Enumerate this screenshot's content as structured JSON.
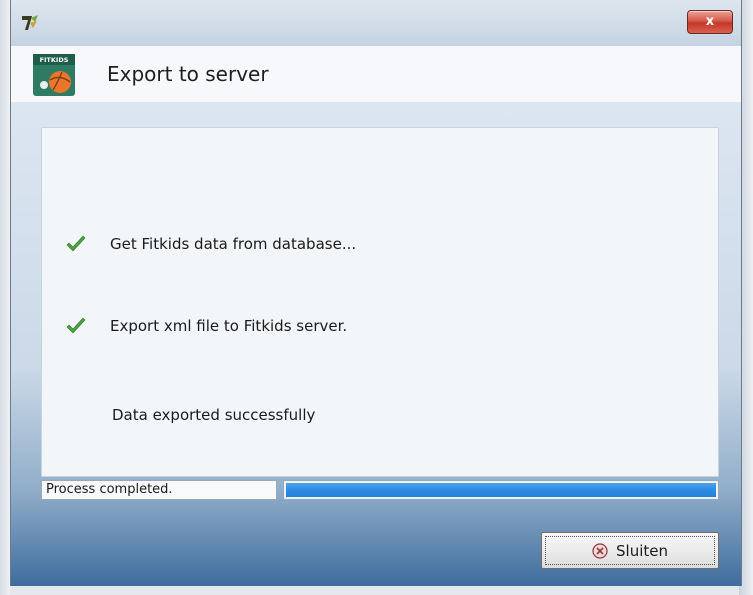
{
  "window": {
    "close_glyph": "x"
  },
  "header": {
    "title": "Export to server",
    "logo_text": "FITKIDS"
  },
  "steps": [
    {
      "label": "Get Fitkids data from database...",
      "status": "done",
      "icon": "check-icon"
    },
    {
      "label": "Export xml file to Fitkids server.",
      "status": "done",
      "icon": "check-icon"
    }
  ],
  "result": {
    "message": "Data exported successfully"
  },
  "status_bar": {
    "text": "Process completed.",
    "progress_percent": 100
  },
  "buttons": {
    "close_label": "Sluiten",
    "close_icon": "cancel-circle-icon"
  },
  "colors": {
    "progress": "#2d8be3",
    "check": "#4aa33c",
    "title_close": "#c2382a"
  }
}
